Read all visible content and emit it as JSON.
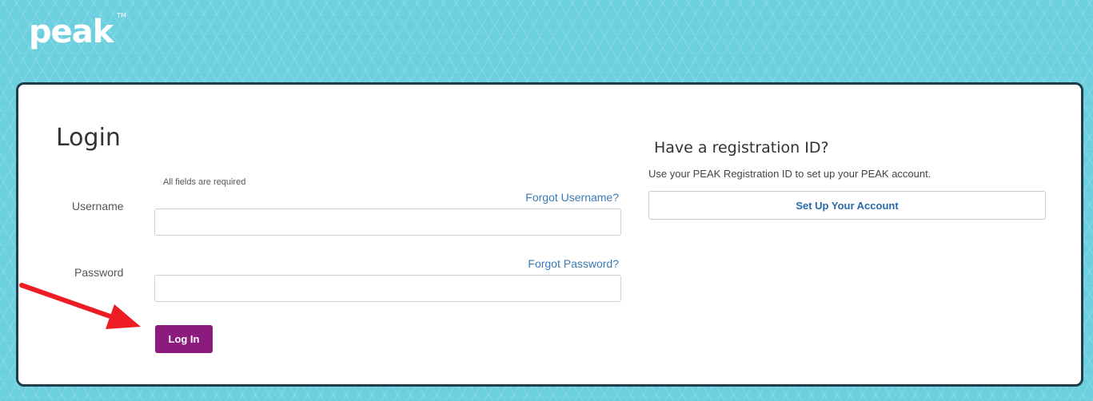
{
  "brand": {
    "logo_text": "peak",
    "trademark": "TM"
  },
  "login": {
    "title": "Login",
    "required_note": "All fields are required",
    "username_label": "Username",
    "password_label": "Password",
    "forgot_username": "Forgot Username?",
    "forgot_password": "Forgot Password?",
    "username_value": "",
    "password_value": "",
    "login_button": "Log In"
  },
  "registration": {
    "title": "Have a registration ID?",
    "description": "Use your PEAK Registration ID to set up your PEAK account.",
    "setup_button": "Set Up Your Account"
  },
  "colors": {
    "background": "#6cd0df",
    "card_border": "#1f3d4a",
    "login_button": "#8b1c7e",
    "link": "#3a7ab5",
    "annotation_arrow": "#ee1c24"
  },
  "icons": {
    "annotation": "red-arrow-icon"
  }
}
